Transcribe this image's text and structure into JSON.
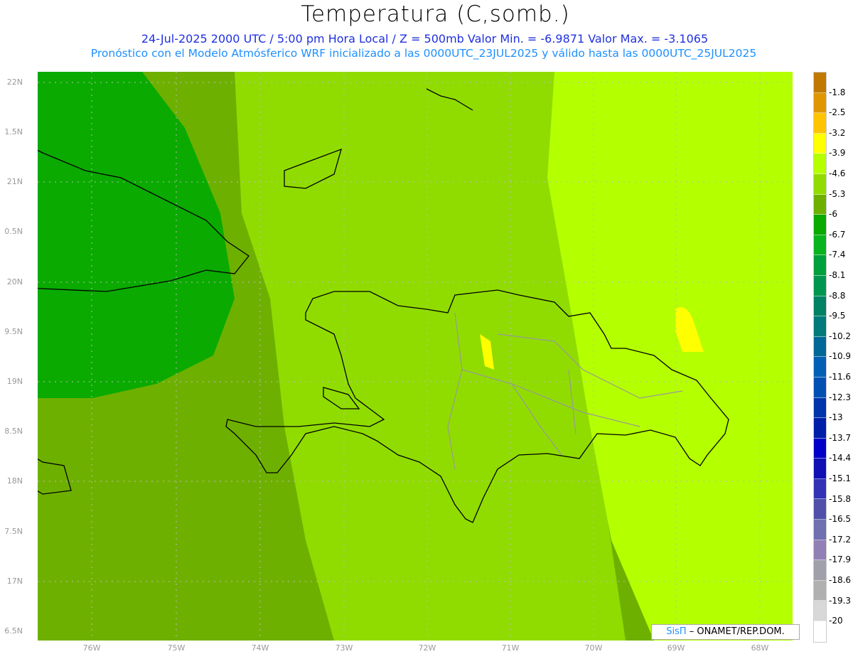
{
  "title": "Temperatura (C,somb.)",
  "line1": "24-Jul-2025   2000 UTC / 5:00 pm Hora Local / Z = 500mb    Valor Min. = -6.9871   Valor Max. = -3.1065",
  "line2": "Pronóstico con el Modelo Atmósferico WRF inicializado a las 0000UTC_23JUL2025 y válido hasta las  0000UTC_25JUL2025",
  "lat_labels": [
    "22N",
    "1.5N",
    "21N",
    "0.5N",
    "20N",
    "9.5N",
    "19N",
    "8.5N",
    "18N",
    "7.5N",
    "17N",
    "6.5N"
  ],
  "lon_labels": [
    "76W",
    "75W",
    "74W",
    "73W",
    "72W",
    "71W",
    "70W",
    "69W",
    "68W"
  ],
  "colorbar": {
    "colors": [
      "#c07800",
      "#e09600",
      "#ffc400",
      "#ffff00",
      "#b4ff00",
      "#90dc00",
      "#6eb000",
      "#0aaa00",
      "#0ab41e",
      "#00a03c",
      "#009650",
      "#008264",
      "#007a7a",
      "#006898",
      "#0060b4",
      "#0050b4",
      "#0034aa",
      "#001ea8",
      "#0000c8",
      "#1010b4",
      "#3232b4",
      "#5050aa",
      "#7070b0",
      "#9080b4",
      "#a0a0aa",
      "#b0b0b0",
      "#d8d8d8",
      "#ffffff"
    ],
    "labels": [
      "-1.8",
      "-2.5",
      "-3.2",
      "-3.9",
      "-4.6",
      "-5.3",
      "-6",
      "-6.7",
      "-7.4",
      "-8.1",
      "-8.8",
      "-9.5",
      "-10.2",
      "-10.9",
      "-11.6",
      "-12.3",
      "-13",
      "-13.7",
      "-14.4",
      "-15.1",
      "-15.8",
      "-16.5",
      "-17.2",
      "-17.9",
      "-18.6",
      "-19.3",
      "-20"
    ]
  },
  "credit": {
    "brand": "SisΠ",
    "rest": " – ONAMET/REP.DOM."
  }
}
